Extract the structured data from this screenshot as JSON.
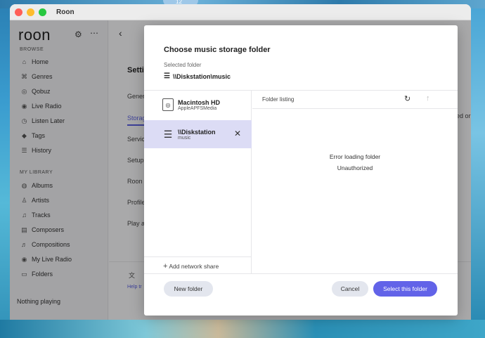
{
  "window": {
    "title": "Roon"
  },
  "desktop": {
    "clock_text": "12"
  },
  "sidebar": {
    "logo": "roon",
    "browse_title": "BROWSE",
    "browse_items": [
      {
        "label": "Home",
        "icon": "home-icon",
        "glyph": "⌂"
      },
      {
        "label": "Genres",
        "icon": "genres-icon",
        "glyph": "⌘"
      },
      {
        "label": "Qobuz",
        "icon": "qobuz-icon",
        "glyph": "◎"
      },
      {
        "label": "Live Radio",
        "icon": "radio-icon",
        "glyph": "◉"
      },
      {
        "label": "Listen Later",
        "icon": "clock-icon",
        "glyph": "◷"
      },
      {
        "label": "Tags",
        "icon": "tag-icon",
        "glyph": "◆"
      },
      {
        "label": "History",
        "icon": "history-icon",
        "glyph": "☰"
      }
    ],
    "library_title": "MY LIBRARY",
    "library_items": [
      {
        "label": "Albums",
        "icon": "album-icon",
        "glyph": "◍"
      },
      {
        "label": "Artists",
        "icon": "artist-icon",
        "glyph": "♙"
      },
      {
        "label": "Tracks",
        "icon": "track-icon",
        "glyph": "♫"
      },
      {
        "label": "Composers",
        "icon": "composer-icon",
        "glyph": "▤"
      },
      {
        "label": "Compositions",
        "icon": "composition-icon",
        "glyph": "♬"
      },
      {
        "label": "My Live Radio",
        "icon": "my-radio-icon",
        "glyph": "◉"
      },
      {
        "label": "Folders",
        "icon": "folder-icon",
        "glyph": "▭"
      }
    ],
    "now_playing": "Nothing playing"
  },
  "main": {
    "title": "Setti",
    "items": [
      "Gener",
      "Storag",
      "Servic",
      "Setup",
      "Roon",
      "Profile",
      "Play a"
    ],
    "right_text": "ed or modi",
    "help": "Help tr"
  },
  "dialog": {
    "title": "Choose music storage folder",
    "selected_label": "Selected folder",
    "selected_path": "\\\\Diskstation\\music",
    "volumes": [
      {
        "name": "Macintosh HD",
        "sub": "AppleAPFSMedia",
        "selected": false
      },
      {
        "name": "\\\\Diskstation",
        "sub": "music",
        "selected": true
      }
    ],
    "add_share": "Add network share",
    "listing_title": "Folder listing",
    "error_line1": "Error loading folder",
    "error_line2": "Unauthorized",
    "buttons": {
      "new_folder": "New folder",
      "cancel": "Cancel",
      "select": "Select this folder"
    },
    "accent_color": "#6263e8"
  }
}
